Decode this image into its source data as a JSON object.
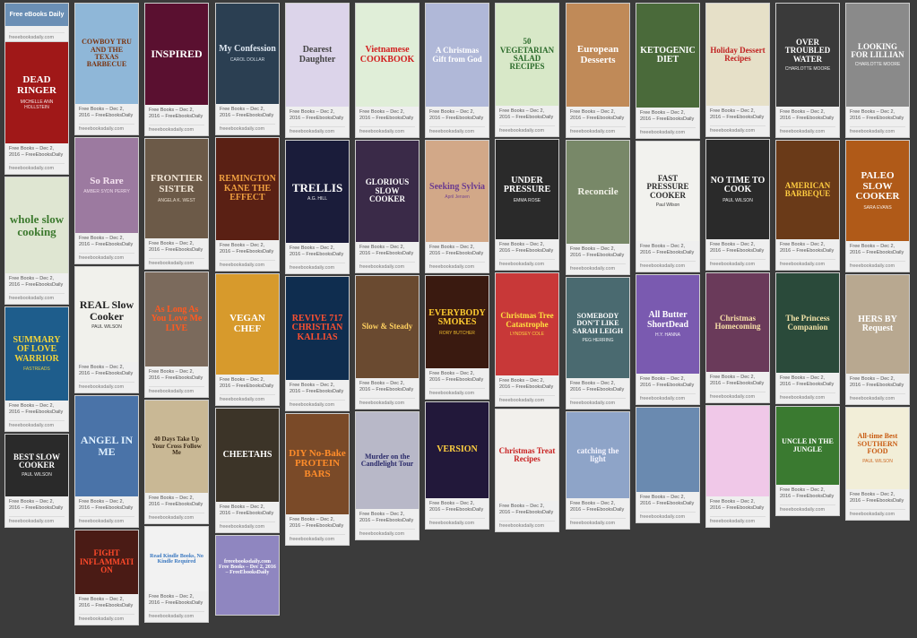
{
  "caption_default": "Free Books – Dec 2, 2016 – FreeEbooksDaily",
  "source": "freeebooksdaily.com",
  "columns": [
    [
      {
        "title": "Free eBooks Daily",
        "h": 25,
        "bg": "#6b8fb5",
        "fg": "#ffffff",
        "fs": 7,
        "header": true
      },
      {
        "title": "DEAD RINGER",
        "sub": "MICHELLE ANN HOLLSTEIN",
        "h": 113,
        "bg": "#a01818",
        "fg": "#ffffff",
        "fs": 11
      },
      {
        "title": "whole slow cooking",
        "h": 107,
        "bg": "#dfe6d2",
        "fg": "#3d7a2f",
        "fs": 13
      },
      {
        "title": "SUMMARY OF LOVE WARRIOR",
        "sub": "FASTREADS",
        "h": 104,
        "bg": "#1e5d8c",
        "fg": "#f2d43a",
        "fs": 10
      },
      {
        "title": "BEST SLOW COOKER",
        "sub": "PAUL WILSON",
        "h": 69,
        "bg": "#2a2a2a",
        "fg": "#ffffff",
        "fs": 9
      }
    ],
    [
      {
        "title": "COWBOY TRU AND THE TEXAS BARBECUE",
        "h": 112,
        "bg": "#8fb7d8",
        "fg": "#7a3410",
        "fs": 8
      },
      {
        "title": "So Rare",
        "sub": "AMBER SYDN PERRY",
        "h": 106,
        "bg": "#9c7aa0",
        "fg": "#f4e2f0",
        "fs": 11
      },
      {
        "title": "REAL Slow Cooker",
        "sub": "PAUL WILSON",
        "h": 106,
        "bg": "#f1f1ec",
        "fg": "#222222",
        "fs": 12
      },
      {
        "title": "ANGEL IN ME",
        "h": 112,
        "bg": "#4a73a8",
        "fg": "#dff0ff",
        "fs": 12
      },
      {
        "title": "FIGHT INFLAMMATION",
        "h": 71,
        "bg": "#4a1b15",
        "fg": "#ff4a2a",
        "fs": 9
      }
    ],
    [
      {
        "title": "INSPIRED",
        "h": 113,
        "bg": "#5a1030",
        "fg": "#ffffff",
        "fs": 12
      },
      {
        "title": "FRONTIER SISTER",
        "sub": "ANGELA K. WEST",
        "h": 111,
        "bg": "#6c5a48",
        "fg": "#f2e6d6",
        "fs": 11
      },
      {
        "title": "As Long As You Love Me LIVE",
        "h": 105,
        "bg": "#7b6a5c",
        "fg": "#ff5a20",
        "fs": 10
      },
      {
        "title": "40 Days Take Up Your Cross Follow Me",
        "h": 103,
        "bg": "#c9b895",
        "fg": "#3a2a18",
        "fs": 7
      },
      {
        "title": "Read Kindle Books, No Kindle Required",
        "h": 72,
        "bg": "#f2f2f2",
        "fg": "#3a78c0",
        "fs": 6
      }
    ],
    [
      {
        "title": "My Confession",
        "sub": "CAROL DOLLAR",
        "h": 112,
        "bg": "#2b3f52",
        "fg": "#dfe8f2",
        "fs": 10
      },
      {
        "title": "REMINGTON KANE THE EFFECT",
        "h": 114,
        "bg": "#5a2014",
        "fg": "#f0a040",
        "fs": 10
      },
      {
        "title": "VEGAN CHEF",
        "h": 112,
        "bg": "#d79a2c",
        "fg": "#ffffff",
        "fs": 11
      },
      {
        "title": "CHEETAHS",
        "h": 104,
        "bg": "#3c3428",
        "fg": "#ffffff",
        "fs": 10
      },
      {
        "title": "freeebooksdaily.com Free Books – Dec 2, 2016 – FreeEbooksDaily",
        "h": 70,
        "bg": "#8f86c0",
        "fg": "#ffffff",
        "fs": 6,
        "nocap": true
      }
    ],
    [
      {
        "title": "Dearest Daughter",
        "h": 115,
        "bg": "#dcd4ea",
        "fg": "#444444",
        "fs": 10
      },
      {
        "title": "TRELLIS",
        "sub": "A.G. HILL",
        "h": 114,
        "bg": "#1a1c3a",
        "fg": "#ffffff",
        "fs": 13
      },
      {
        "title": "REVIVE 717 CHRISTIAN KALLIAS",
        "h": 115,
        "bg": "#0f2d4f",
        "fg": "#ff5030",
        "fs": 10
      },
      {
        "title": "DIY No-Bake PROTEIN BARS",
        "h": 112,
        "bg": "#7a4a28",
        "fg": "#ff8c2a",
        "fs": 11
      }
    ],
    [
      {
        "title": "Vietnamese COOKBOOK",
        "h": 115,
        "bg": "#e0eed8",
        "fg": "#d22020",
        "fs": 10
      },
      {
        "title": "GLORIOUS SLOW COOKER",
        "h": 113,
        "bg": "#3a2a48",
        "fg": "#ffffff",
        "fs": 9
      },
      {
        "title": "Slow & Steady",
        "h": 114,
        "bg": "#6a4a30",
        "fg": "#ffd060",
        "fs": 9
      },
      {
        "title": "Murder on the Candlelight Tour",
        "h": 108,
        "bg": "#b8b8c8",
        "fg": "#2a2a6a",
        "fs": 8
      }
    ],
    [
      {
        "title": "A Christmas Gift from God",
        "h": 115,
        "bg": "#b0b8d8",
        "fg": "#ffffff",
        "fs": 9
      },
      {
        "title": "Seeking Sylvia",
        "sub": "April Jensen",
        "h": 113,
        "bg": "#d2a888",
        "fg": "#6a3a90",
        "fs": 10
      },
      {
        "title": "EVERYBODY SMOKES",
        "sub": "RORY BUTCHER",
        "h": 103,
        "bg": "#3a1a10",
        "fg": "#ffcc30",
        "fs": 10
      },
      {
        "title": "VERSION",
        "h": 107,
        "bg": "#22183a",
        "fg": "#ffd040",
        "fs": 10
      }
    ],
    [
      {
        "title": "50 VEGETARIAN SALAD RECIPES",
        "h": 114,
        "bg": "#d8e8c8",
        "fg": "#2a6a2a",
        "fs": 9
      },
      {
        "title": "UNDER PRESSURE",
        "sub": "EMMA ROSE",
        "h": 111,
        "bg": "#2a2a2a",
        "fg": "#ffffff",
        "fs": 10
      },
      {
        "title": "Christmas Tree Catastrophe",
        "sub": "LYNDSEY COLE",
        "h": 114,
        "bg": "#c83838",
        "fg": "#ffe040",
        "fs": 9
      },
      {
        "title": "Christmas Treat Recipes",
        "h": 102,
        "bg": "#f2f0ec",
        "fg": "#c82020",
        "fs": 9
      }
    ],
    [
      {
        "title": "European Desserts",
        "h": 115,
        "bg": "#c08a58",
        "fg": "#ffffff",
        "fs": 11
      },
      {
        "title": "Reconcile",
        "h": 115,
        "bg": "#788868",
        "fg": "#f2f2e8",
        "fs": 11
      },
      {
        "title": "SOMEBODY DON'T LIKE SARAH LEIGH",
        "sub": "PEG HERRING",
        "h": 112,
        "bg": "#4a6a70",
        "fg": "#ffffff",
        "fs": 8
      },
      {
        "title": "catching the light",
        "h": 96,
        "bg": "#8ea4c8",
        "fg": "#f4f4ff",
        "fs": 9
      }
    ],
    [
      {
        "title": "KETOGENIC DIET",
        "h": 116,
        "bg": "#4a6a3a",
        "fg": "#ffffff",
        "fs": 10
      },
      {
        "title": "FAST PRESSURE COOKER",
        "sub": "Paul Wilson",
        "h": 111,
        "bg": "#f2f2ee",
        "fg": "#2a2a2a",
        "fs": 9
      },
      {
        "title": "All Butter ShortDead",
        "sub": "H.Y. HANNA",
        "h": 110,
        "bg": "#7a5ab0",
        "fg": "#ffffff",
        "fs": 10
      },
      {
        "title": "",
        "h": 94,
        "bg": "#6a8ab0",
        "fg": "#ffffff",
        "fs": 9
      }
    ],
    [
      {
        "title": "Holiday Dessert Recipes",
        "h": 114,
        "bg": "#e6e0c8",
        "fg": "#c02020",
        "fs": 9
      },
      {
        "title": "NO TIME TO COOK",
        "sub": "PAUL WILSON",
        "h": 111,
        "bg": "#2a2a2a",
        "fg": "#ffffff",
        "fs": 10
      },
      {
        "title": "Christmas Homecoming",
        "h": 110,
        "bg": "#6a3a5a",
        "fg": "#f8e0a8",
        "fs": 9
      },
      {
        "title": "",
        "h": 101,
        "bg": "#f0c8e8",
        "fg": "#7a2a7a",
        "fs": 9
      }
    ],
    [
      {
        "title": "OVER TROUBLED WATER",
        "sub": "CHARLOTTE MOORE",
        "h": 115,
        "bg": "#3a3a3a",
        "fg": "#ffffff",
        "fs": 9
      },
      {
        "title": "AMERICAN BARBEQUE",
        "h": 110,
        "bg": "#6a3a18",
        "fg": "#ffcc40",
        "fs": 9
      },
      {
        "title": "The Princess Companion",
        "h": 111,
        "bg": "#2a4a3a",
        "fg": "#f2e2a8",
        "fs": 9
      },
      {
        "title": "UNCLE IN THE JUNGLE",
        "h": 87,
        "bg": "#3a7a30",
        "fg": "#ffffff",
        "fs": 8
      }
    ],
    [
      {
        "title": "LOOKING FOR LILLIAN",
        "sub": "CHARLOTTE MOORE",
        "h": 115,
        "bg": "#8a8a8a",
        "fg": "#ffffff",
        "fs": 9
      },
      {
        "title": "PALEO SLOW COOKER",
        "sub": "SARA EVANS",
        "h": 112,
        "bg": "#b05a18",
        "fg": "#ffffff",
        "fs": 11
      },
      {
        "title": "HERS BY Request",
        "h": 110,
        "bg": "#b8a890",
        "fg": "#ffffff",
        "fs": 10
      },
      {
        "title": "All-time Best SOUTHERN FOOD",
        "sub": "PAUL WILSON",
        "h": 91,
        "bg": "#f2eed8",
        "fg": "#c85a10",
        "fs": 8
      }
    ]
  ]
}
